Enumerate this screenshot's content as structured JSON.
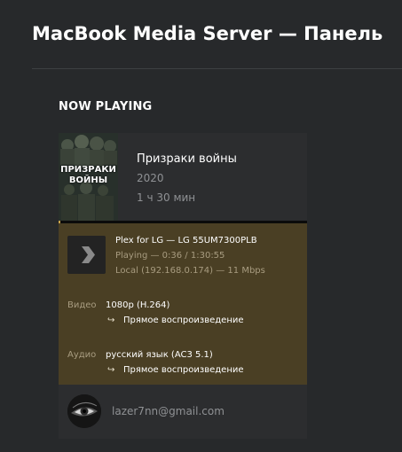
{
  "page": {
    "title": "MacBook Media Server — Панель"
  },
  "now_playing": {
    "section_title": "NOW PLAYING",
    "media": {
      "poster_text_line1": "ПРИЗРАКИ",
      "poster_text_line2": "ВОЙНЫ",
      "title": "Призраки войны",
      "year": "2020",
      "duration": "1 ч 30 мин"
    },
    "progress": {
      "fraction": 0.0068
    },
    "player": {
      "icon": "plex-chevron-icon",
      "name": "Plex for LG — LG 55UM7300PLB",
      "status": "Playing — 0:36 / 1:30:55",
      "network": "Local (192.168.0.174) — 11 Mbps"
    },
    "video": {
      "label": "Видео",
      "value": "1080p (H.264)",
      "decision": "Прямое воспроизведение"
    },
    "audio": {
      "label": "Аудио",
      "value": "русский язык (AC3 5.1)",
      "decision": "Прямое воспроизведение"
    },
    "user": {
      "email": "lazer7nn@gmail.com"
    }
  },
  "colors": {
    "background": "#27292b",
    "card": "#1f2021",
    "player_block": "#4a3f24",
    "progress_accent": "#c8a24a"
  }
}
